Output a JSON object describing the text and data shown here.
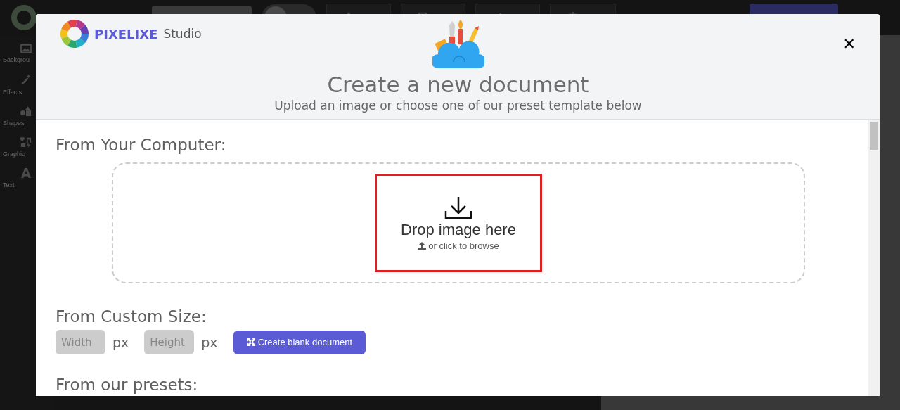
{
  "app": {
    "theme_toggle": {
      "on": false
    }
  },
  "sidebar": [
    {
      "label": "Backgrou"
    },
    {
      "label": "Effects"
    },
    {
      "label": "Shapes"
    },
    {
      "label": "Graphic"
    },
    {
      "label": "Text"
    }
  ],
  "dialog": {
    "brand": "PIXELIXE",
    "brand_suffix": "Studio",
    "close": "✕",
    "title": "Create a new document",
    "subtitle": "Upload an image or choose one of our preset template below",
    "computer_heading": "From Your Computer:",
    "drop_text": "Drop image here",
    "browse_link": "or click to browse",
    "custom_heading": "From Custom Size:",
    "width_placeholder": "Width",
    "width_unit": "px",
    "height_placeholder": "Height",
    "height_unit": "px",
    "create_button": "Create blank document",
    "presets_heading": "From our presets:"
  }
}
